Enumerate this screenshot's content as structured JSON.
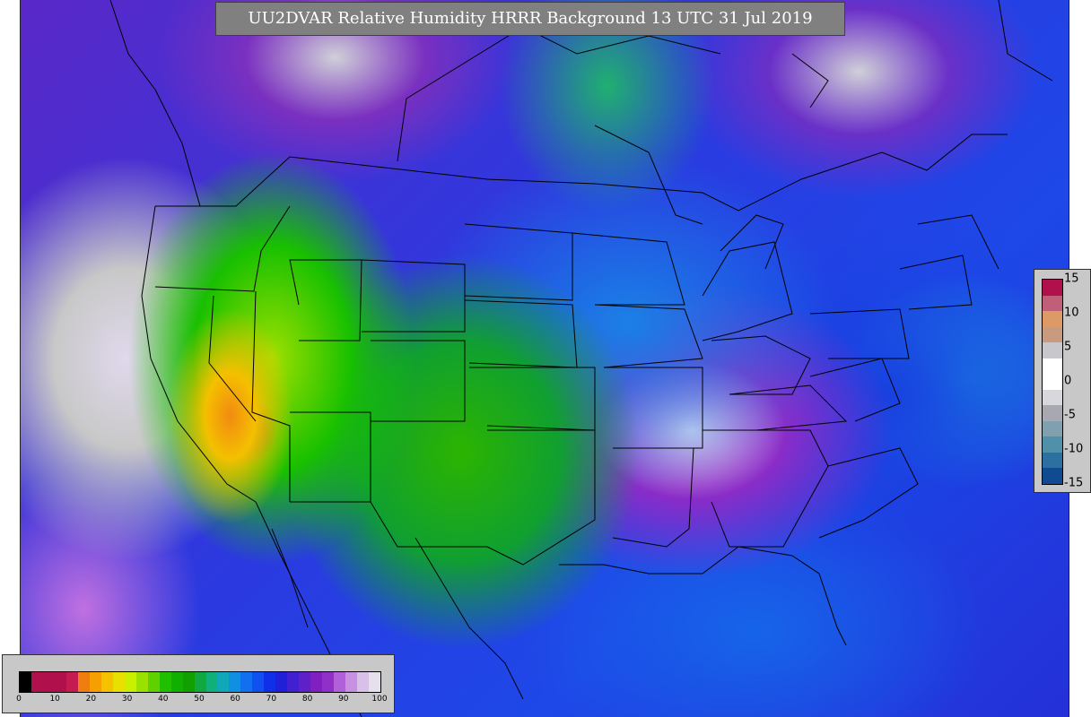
{
  "title": "UU2DVAR Relative Humidity HRRR Background  13 UTC 31 Jul 2019",
  "map": {
    "variable": "Relative Humidity",
    "model": "HRRR Background",
    "valid_time": "13 UTC 31 Jul 2019",
    "region": "CONUS"
  },
  "rh_colorbar": {
    "ticks": [
      "0",
      "10",
      "20",
      "30",
      "40",
      "50",
      "60",
      "70",
      "80",
      "90",
      "100"
    ],
    "segment_colors": [
      "#000000",
      "#b0104c",
      "#b0104c",
      "#b0104c",
      "#c41b50",
      "#f07d10",
      "#f5a000",
      "#f6c200",
      "#e8e000",
      "#c8f000",
      "#9ae000",
      "#5fd000",
      "#20c000",
      "#10b000",
      "#10a000",
      "#10a840",
      "#10b07a",
      "#10a8b8",
      "#1090e0",
      "#1070f0",
      "#1050f0",
      "#1030e8",
      "#2020d8",
      "#4020d0",
      "#6020c8",
      "#8020c0",
      "#9030c8",
      "#b060d8",
      "#c890e0",
      "#d8c0e8",
      "#e6e0ec"
    ]
  },
  "increment_colorbar": {
    "ticks": [
      "15",
      "10",
      "5",
      "0",
      "-5",
      "-10",
      "-15"
    ],
    "segment_colors": [
      "#b0104c",
      "#c06078",
      "#de9a66",
      "#c89a80",
      "#c8c8cc",
      "#ffffff",
      "#ffffff",
      "#d8d8dc",
      "#a8a8b0",
      "#80a0b0",
      "#5090a8",
      "#2c70a0",
      "#104a90"
    ]
  },
  "colors": {
    "border_lines": "#000000",
    "title_background": "#808080",
    "title_text": "#ffffff",
    "panel_background": "#c8c8c8"
  }
}
